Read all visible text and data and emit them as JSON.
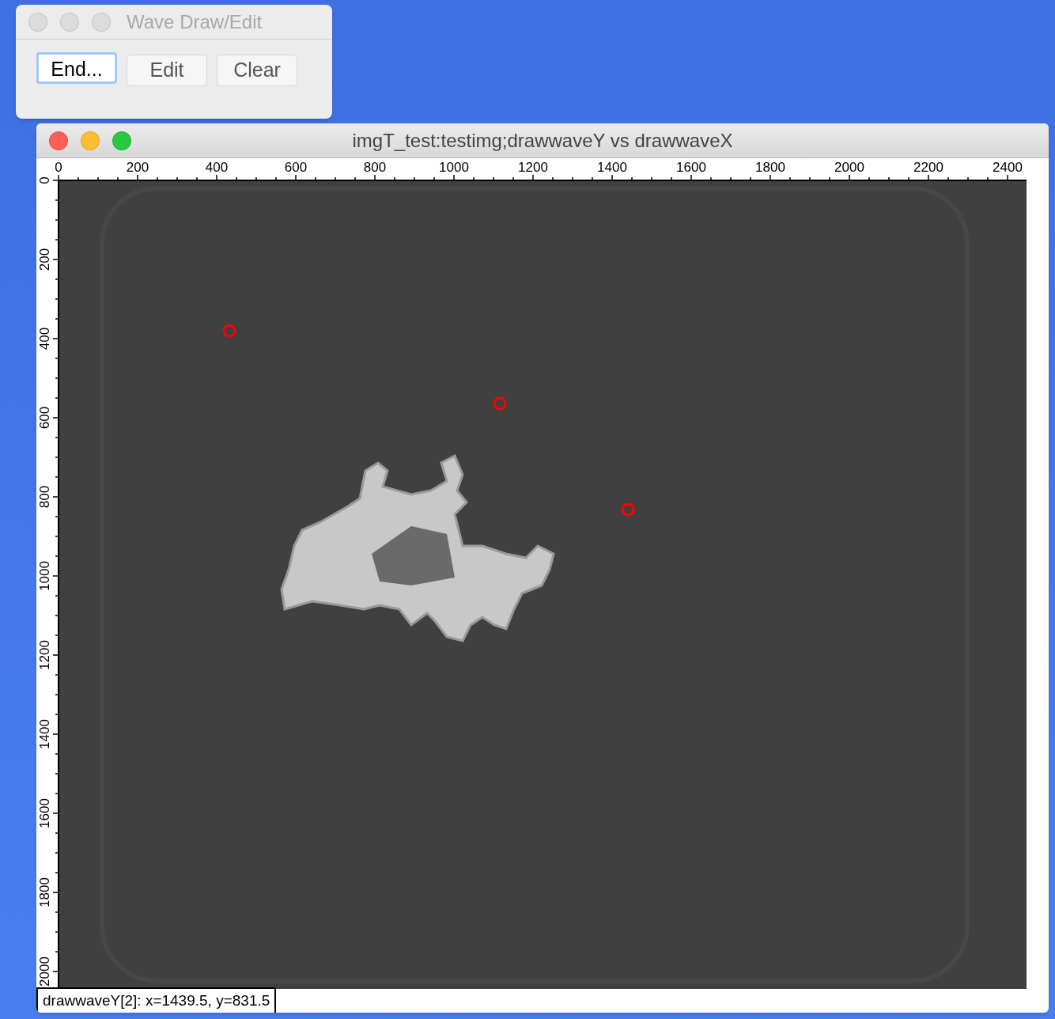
{
  "tool_window": {
    "title": "Wave Draw/Edit",
    "active": false,
    "buttons": [
      {
        "label": "End...",
        "focused": true
      },
      {
        "label": "Edit",
        "focused": false
      },
      {
        "label": "Clear",
        "focused": false
      }
    ]
  },
  "graph_window": {
    "title": "imgT_test:testimg;drawwaveY vs drawwaveX",
    "active": true,
    "chart_data": {
      "type": "scatter",
      "xlim": [
        0,
        2448
      ],
      "ylim": [
        2044,
        0
      ],
      "xticks": [
        0,
        200,
        400,
        600,
        800,
        1000,
        1200,
        1400,
        1600,
        1800,
        2000,
        2200,
        2400
      ],
      "yticks": [
        0,
        200,
        400,
        600,
        800,
        1000,
        1200,
        1400,
        1600,
        1800,
        2000
      ],
      "series": [
        {
          "color": "#ff0000",
          "x": [
            432,
            1116,
            1440
          ],
          "values": [
            380,
            564,
            832
          ]
        }
      ]
    },
    "status": "drawwaveY[2]: x=1439.5, y=831.5"
  }
}
